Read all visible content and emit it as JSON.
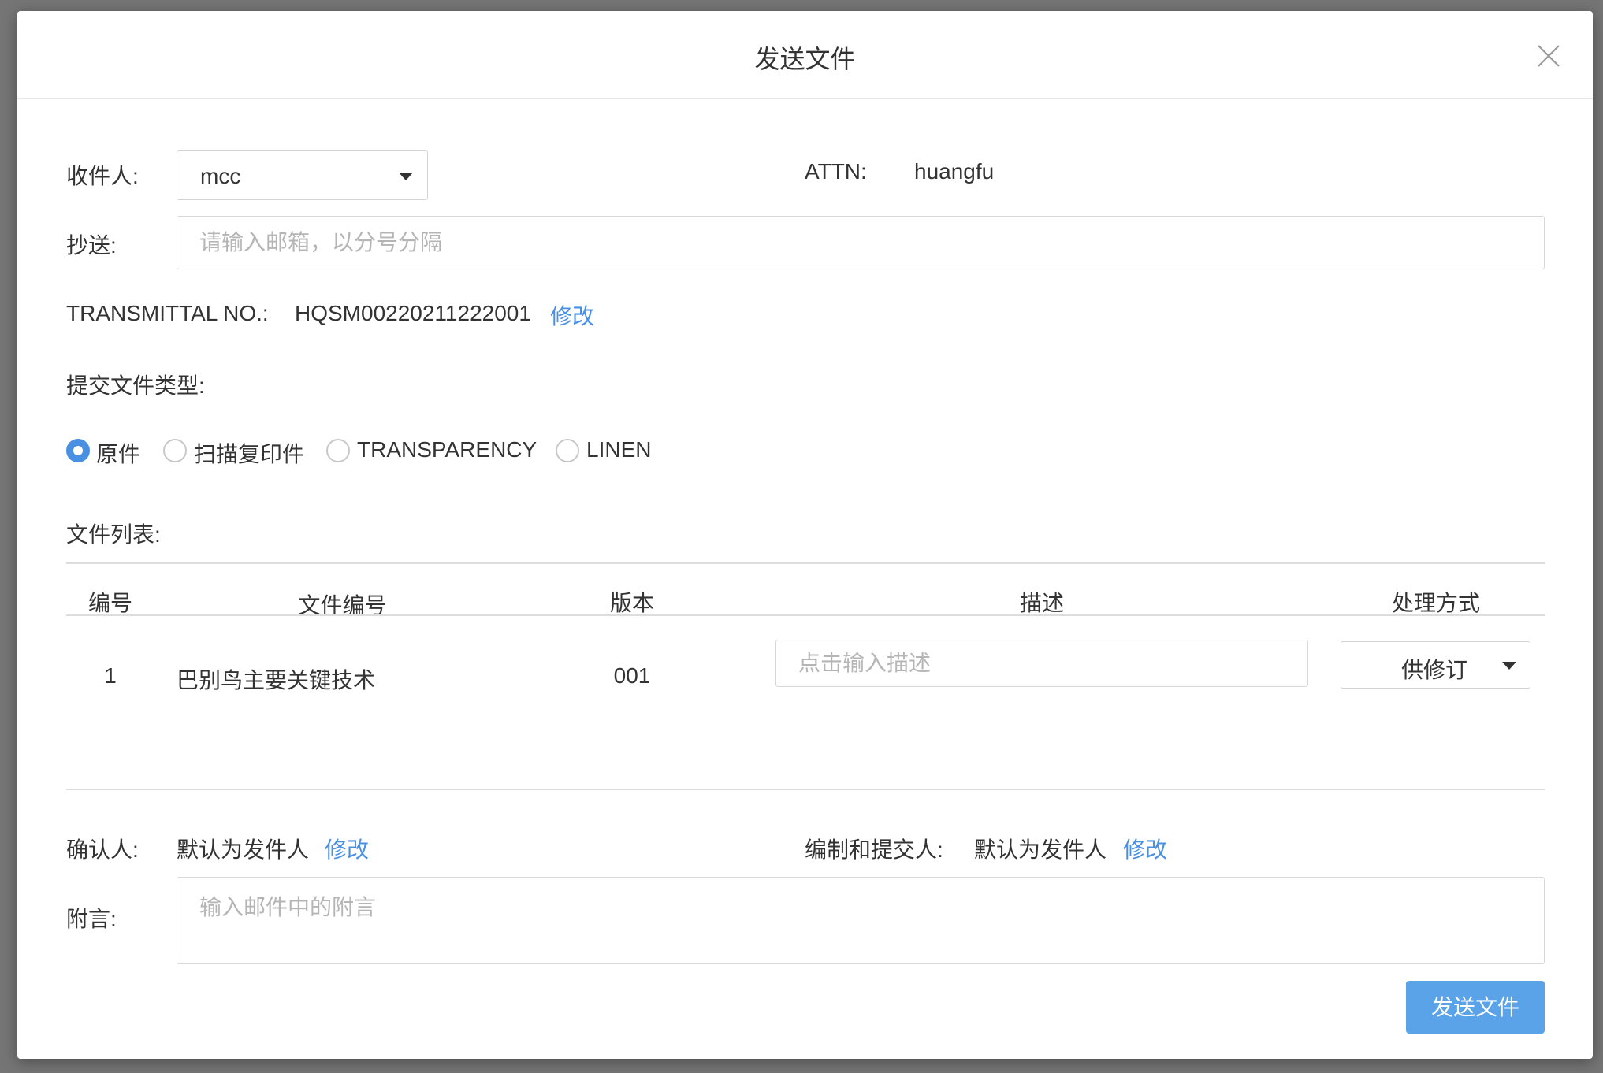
{
  "dialog": {
    "title": "发送文件",
    "close_icon": "close-icon"
  },
  "recipient": {
    "label": "收件人:",
    "value": "mcc"
  },
  "attn": {
    "label": "ATTN:",
    "value": "huangfu"
  },
  "cc": {
    "label": "抄送:",
    "placeholder": "请输入邮箱，以分号分隔"
  },
  "transmittal": {
    "label": "TRANSMITTAL NO.:",
    "value": "HQSM00220211222001",
    "edit_label": "修改"
  },
  "file_type": {
    "label": "提交文件类型:",
    "options": [
      "原件",
      "扫描复印件",
      "TRANSPARENCY",
      "LINEN"
    ],
    "selected": "原件"
  },
  "file_list": {
    "label": "文件列表:",
    "columns": [
      "编号",
      "文件编号",
      "版本",
      "描述",
      "处理方式"
    ],
    "rows": [
      {
        "no": "1",
        "file_no": "巴别鸟主要关键技术",
        "version": "001",
        "description_placeholder": "点击输入描述",
        "handling": "供修订"
      }
    ]
  },
  "confirmer": {
    "label": "确认人:",
    "value": "默认为发件人",
    "edit_label": "修改"
  },
  "preparer": {
    "label": "编制和提交人:",
    "value": "默认为发件人",
    "edit_label": "修改"
  },
  "note": {
    "label": "附言:",
    "placeholder": "输入邮件中的附言"
  },
  "submit": {
    "label": "发送文件"
  },
  "colors": {
    "accent": "#4a90e2",
    "button": "#5aa3e8",
    "backdrop": "#757575"
  }
}
